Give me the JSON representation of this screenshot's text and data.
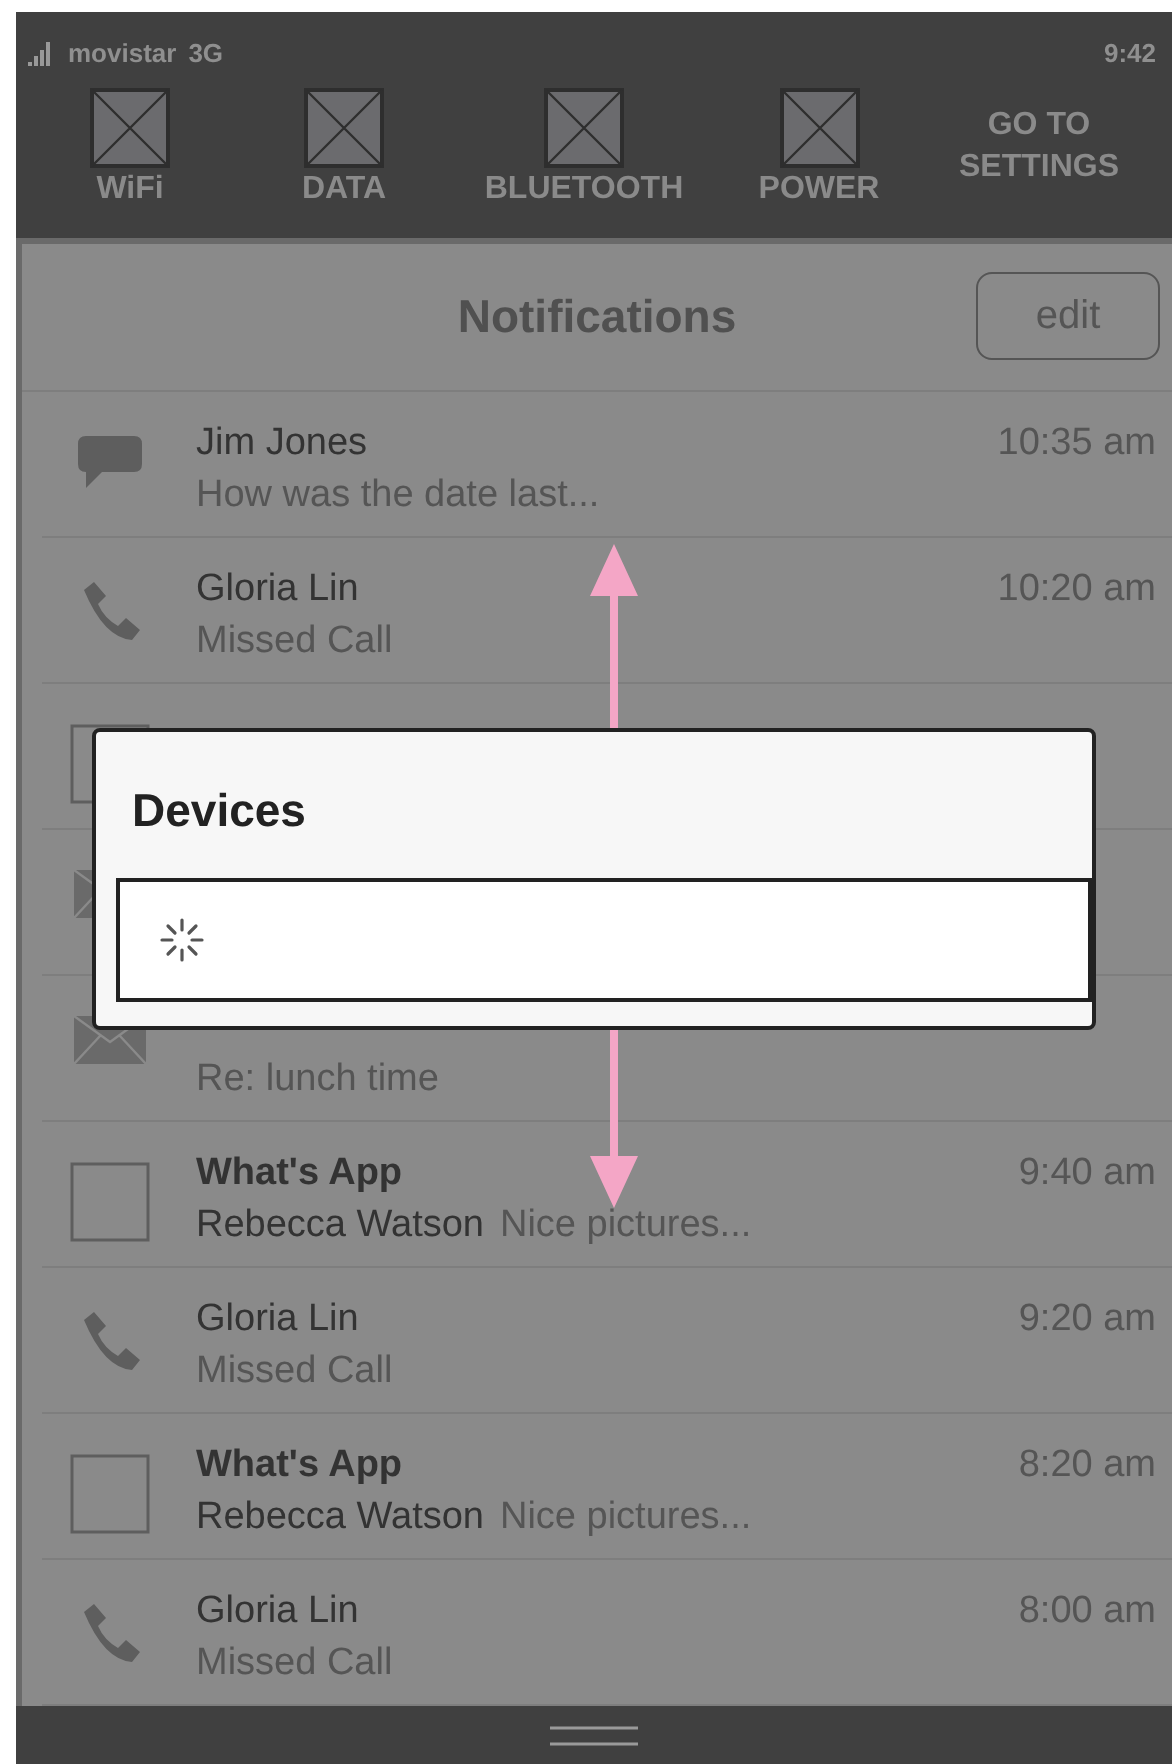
{
  "status_bar": {
    "carrier": "movistar",
    "network": "3G",
    "time": "9:42"
  },
  "quick_toggles": [
    {
      "label": "WiFi"
    },
    {
      "label": "DATA"
    },
    {
      "label": "BLUETOOTH"
    },
    {
      "label": "POWER"
    }
  ],
  "settings_link": {
    "lines": [
      "GO TO",
      "SETTINGS"
    ]
  },
  "header": {
    "title": "Notifications",
    "edit_button": "edit"
  },
  "notifications": [
    {
      "kind": "chat",
      "title": "Jim Jones",
      "message": "How was the date last...",
      "time": "10:35 am"
    },
    {
      "kind": "phone",
      "title": "Gloria Lin",
      "message": "Missed Call",
      "time": "10:20 am"
    },
    {
      "kind": "app"
    },
    {
      "kind": "mail"
    },
    {
      "kind": "mail",
      "message": "Re: lunch time"
    },
    {
      "kind": "app",
      "title": "What's App",
      "sender": "Rebecca Watson",
      "message": "Nice pictures...",
      "time": "9:40 am"
    },
    {
      "kind": "phone",
      "title": "Gloria Lin",
      "message": "Missed Call",
      "time": "9:20 am"
    },
    {
      "kind": "app",
      "title": "What's App",
      "sender": "Rebecca Watson",
      "message": "Nice pictures...",
      "time": "8:20 am"
    },
    {
      "kind": "phone",
      "title": "Gloria Lin",
      "message": "Missed Call",
      "time": "8:00 am"
    }
  ],
  "dialog": {
    "title": "Devices",
    "loading": true
  }
}
